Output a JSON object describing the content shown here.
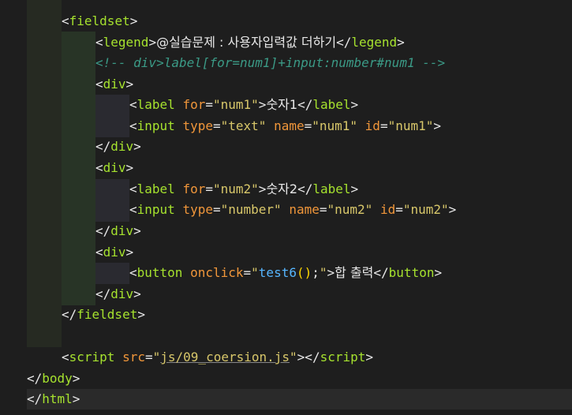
{
  "editor": {
    "legend_text": "@실습문제 : 사용자입력값 더하기",
    "comment_text": "<!-- div>label[for=num1]+input:number#num1 -->",
    "label1_text": "숫자1",
    "label2_text": "숫자2",
    "button_text": "합 출력",
    "num1_for": "\"num1\"",
    "num1_type": "\"text\"",
    "num1_name": "\"num1\"",
    "num1_id": "\"num1\"",
    "num2_for": "\"num2\"",
    "num2_type": "\"number\"",
    "num2_name": "\"num2\"",
    "num2_id": "\"num2\"",
    "onclick_fn": "test6",
    "script_src": "js/09_coersion.js"
  },
  "colors": {
    "background": "#1e1e1e",
    "tag": "#a6e22e",
    "attribute": "#f0963a",
    "string": "#d8c76a",
    "comment": "#3b9a86",
    "function": "#56b6ff"
  }
}
